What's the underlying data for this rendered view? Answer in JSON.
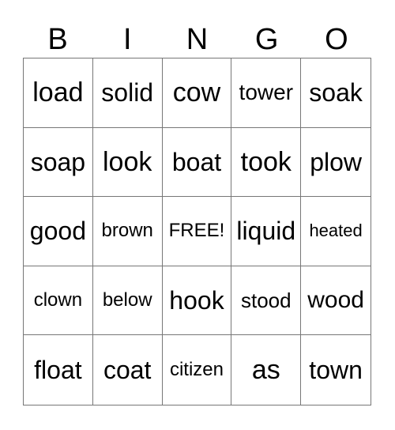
{
  "header": [
    "B",
    "I",
    "N",
    "G",
    "O"
  ],
  "cells": [
    "load",
    "solid",
    "cow",
    "tower",
    "soak",
    "soap",
    "look",
    "boat",
    "took",
    "plow",
    "good",
    "brown",
    "FREE!",
    "liquid",
    "heated",
    "clown",
    "below",
    "hook",
    "stood",
    "wood",
    "float",
    "coat",
    "citizen",
    "as",
    "town"
  ]
}
